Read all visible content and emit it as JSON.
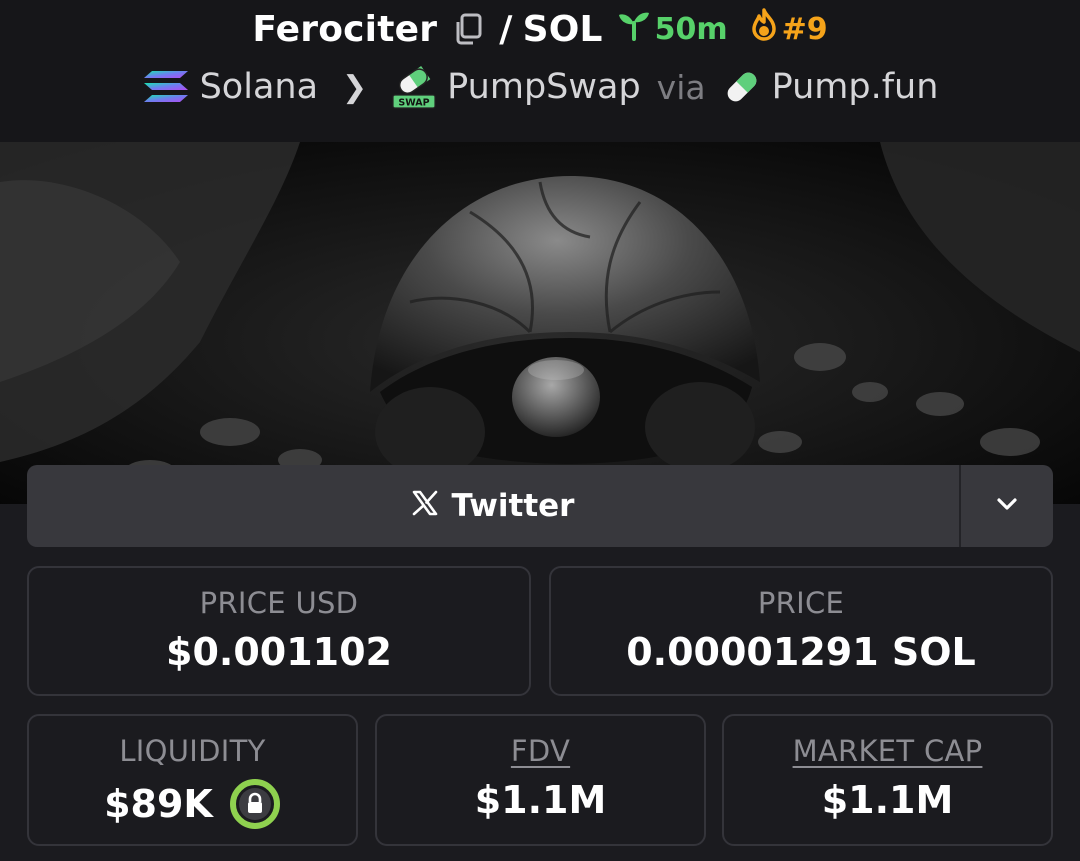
{
  "header": {
    "token_name": "Ferociter",
    "slash": "/",
    "quote_symbol": "SOL",
    "age": "50m",
    "rank": "#9",
    "chain": "Solana",
    "dex": "PumpSwap",
    "dex_icon_text": "SWAP",
    "via": "via",
    "launchpad": "Pump.fun"
  },
  "banner": {
    "subject": "tortoise photo (black and white)"
  },
  "socials": {
    "twitter_label": "Twitter",
    "menu_icon": "chevron-down-icon"
  },
  "stats": {
    "price_usd_label": "PRICE USD",
    "price_usd_value": "$0.001102",
    "price_label": "PRICE",
    "price_value": "0.00001291 SOL",
    "liquidity_label": "LIQUIDITY",
    "liquidity_value": "$89K",
    "fdv_label": "FDV",
    "fdv_value": "$1.1M",
    "mcap_label": "MARKET CAP",
    "mcap_value": "$1.1M"
  },
  "colors": {
    "background": "#1b1b1f",
    "age_green": "#57d16a",
    "rank_orange": "#f5a31a",
    "lock_green": "#8fd14f"
  }
}
